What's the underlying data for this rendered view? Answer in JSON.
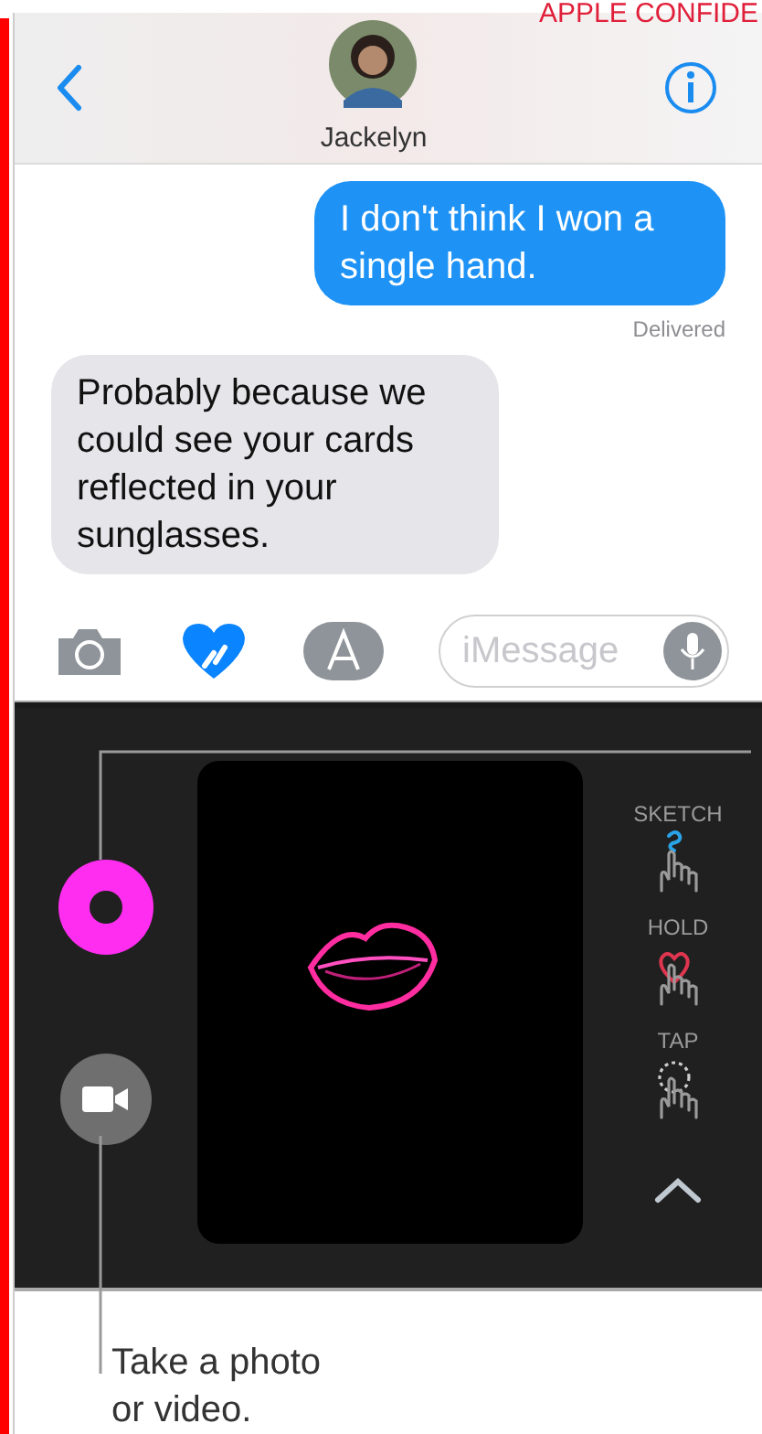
{
  "stamp": "APPLE CONFIDE",
  "header": {
    "contact_name": "Jackelyn"
  },
  "messages": [
    {
      "kind": "sent",
      "text": "I don't think I won a single hand."
    },
    {
      "kind": "status",
      "text": "Delivered"
    },
    {
      "kind": "received",
      "text": "Probably because we could see your cards reflected in your sunglasses."
    }
  ],
  "compose": {
    "placeholder": "iMessage"
  },
  "digital_touch": {
    "modes": [
      {
        "kind": "sketch",
        "label": "SKETCH"
      },
      {
        "kind": "hold",
        "label": "HOLD"
      },
      {
        "kind": "tap",
        "label": "TAP"
      }
    ]
  },
  "callout": "Take a photo or video."
}
